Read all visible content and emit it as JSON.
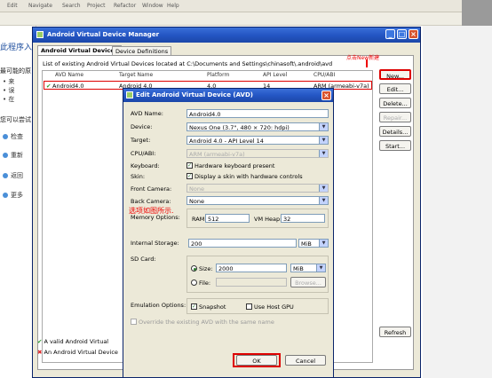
{
  "eclipse": {
    "menu": [
      "Edit",
      "Navigate",
      "Search",
      "Project",
      "Refactor",
      "Window",
      "Help"
    ],
    "left_texts": [
      "此程序入",
      "最可能的原",
      "来",
      "误",
      "在",
      "您可以尝试",
      "检查",
      "重新",
      "返回",
      "更多"
    ]
  },
  "avd_manager": {
    "title": "Android Virtual Device Manager",
    "tabs": [
      "Android Virtual Devices",
      "Device Definitions"
    ],
    "list_caption": "List of existing Android Virtual Devices located at C:\\Documents and Settings\\chinasoft\\.android\\avd",
    "columns": [
      "AVD Name",
      "Target Name",
      "Platform",
      "API Level",
      "CPU/ABI"
    ],
    "rows": [
      {
        "name": "Android4.0",
        "target": "Android 4.0",
        "platform": "4.0",
        "api": "14",
        "cpu": "ARM (armeabi-v7a)"
      }
    ],
    "buttons": {
      "new": "New...",
      "edit": "Edit...",
      "delete": "Delete...",
      "repair": "Repair...",
      "details": "Details...",
      "start": "Start...",
      "refresh": "Refresh"
    },
    "legend_valid": "A valid Android Virtual",
    "legend_invalid": "An Android Virtual Device",
    "annotation_new": "点击New新建"
  },
  "edit_dialog": {
    "title": "Edit Android Virtual Device (AVD)",
    "annotation": "选项如图所示.",
    "labels": {
      "avd_name": "AVD Name:",
      "device": "Device:",
      "target": "Target:",
      "cpu": "CPU/ABI:",
      "keyboard": "Keyboard:",
      "skin": "Skin:",
      "front_camera": "Front Camera:",
      "back_camera": "Back Camera:",
      "memory": "Memory Options:",
      "ram": "RAM:",
      "vm_heap": "VM Heap:",
      "internal_storage": "Internal Storage:",
      "sd_card": "SD Card:",
      "size": "Size:",
      "file": "File:",
      "browse": "Browse...",
      "emulation": "Emulation Options:",
      "snapshot": "Snapshot",
      "use_host_gpu": "Use Host GPU",
      "override": "Override the existing AVD with the same name"
    },
    "values": {
      "avd_name": "Android4.0",
      "device": "Nexus One (3.7\", 480 × 720: hdpi)",
      "target": "Android 4.0 - API Level 14",
      "cpu": "ARM (armeabi-v7a)",
      "keyboard_text": "Hardware keyboard present",
      "skin_text": "Display a skin with hardware controls",
      "front_camera": "None",
      "back_camera": "None",
      "ram": "512",
      "vm_heap": "32",
      "internal_storage": "200",
      "internal_unit": "MiB",
      "sd_size": "2000",
      "sd_unit": "MiB"
    },
    "ok": "OK",
    "cancel": "Cancel"
  }
}
